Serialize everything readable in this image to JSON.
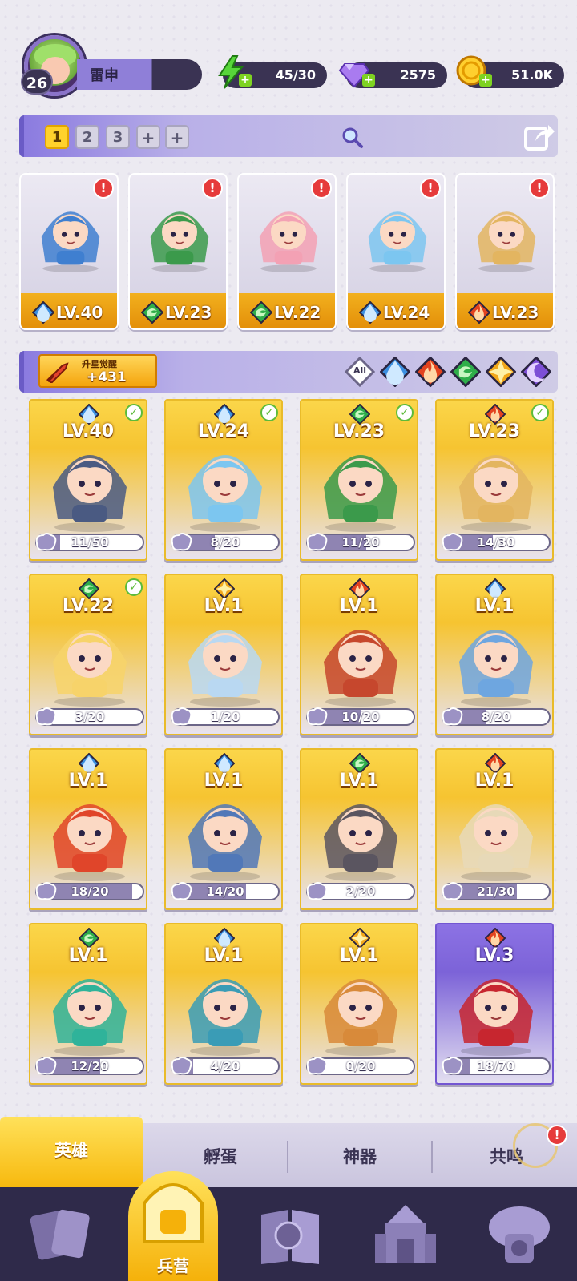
{
  "player": {
    "level": "26",
    "name": "雷申"
  },
  "resources": {
    "energy": "45/30",
    "gems": "2575",
    "gold": "51.0K"
  },
  "team_tabs": [
    "1",
    "2",
    "3",
    "+",
    "+"
  ],
  "team": [
    {
      "level": "LV.40",
      "element": "water",
      "color": "#3f7fd0"
    },
    {
      "level": "LV.23",
      "element": "wind",
      "color": "#3b9a4b"
    },
    {
      "level": "LV.22",
      "element": "wind",
      "color": "#f3a1b4"
    },
    {
      "level": "LV.24",
      "element": "water",
      "color": "#7cc6f0"
    },
    {
      "level": "LV.23",
      "element": "fire",
      "color": "#e3b560"
    }
  ],
  "awaken": {
    "title": "升星觉醒",
    "value": "+431"
  },
  "filters": [
    "All",
    "water",
    "fire",
    "wind",
    "light",
    "dark"
  ],
  "heroes": [
    {
      "level": "LV.40",
      "element": "water",
      "progress": "11/50",
      "ratio": 0.22,
      "checked": true,
      "tint": "#4a5a82"
    },
    {
      "level": "LV.24",
      "element": "water",
      "progress": "8/20",
      "ratio": 0.4,
      "checked": true,
      "tint": "#7cc6f0"
    },
    {
      "level": "LV.23",
      "element": "wind",
      "progress": "11/20",
      "ratio": 0.55,
      "checked": true,
      "tint": "#3b9a4b"
    },
    {
      "level": "LV.23",
      "element": "fire",
      "progress": "14/30",
      "ratio": 0.47,
      "checked": true,
      "tint": "#e3b560"
    },
    {
      "level": "LV.22",
      "element": "wind",
      "progress": "3/20",
      "ratio": 0.15,
      "checked": true,
      "tint": "#f7d36a"
    },
    {
      "level": "LV.1",
      "element": "light",
      "progress": "1/20",
      "ratio": 0.05,
      "checked": false,
      "tint": "#b9d8f2"
    },
    {
      "level": "LV.1",
      "element": "fire",
      "progress": "10/20",
      "ratio": 0.5,
      "checked": false,
      "tint": "#c6472d"
    },
    {
      "level": "LV.1",
      "element": "water",
      "progress": "8/20",
      "ratio": 0.4,
      "checked": false,
      "tint": "#6ea6e0"
    },
    {
      "level": "LV.1",
      "element": "water",
      "progress": "18/20",
      "ratio": 0.9,
      "checked": false,
      "tint": "#e0452a"
    },
    {
      "level": "LV.1",
      "element": "water",
      "progress": "14/20",
      "ratio": 0.7,
      "checked": false,
      "tint": "#5178b8"
    },
    {
      "level": "LV.1",
      "element": "wind",
      "progress": "2/20",
      "ratio": 0.1,
      "checked": false,
      "tint": "#5a5560"
    },
    {
      "level": "LV.1",
      "element": "fire",
      "progress": "21/30",
      "ratio": 0.7,
      "checked": false,
      "tint": "#e7d9b8"
    },
    {
      "level": "LV.1",
      "element": "wind",
      "progress": "12/20",
      "ratio": 0.6,
      "checked": false,
      "tint": "#2fb39a"
    },
    {
      "level": "LV.1",
      "element": "water",
      "progress": "4/20",
      "ratio": 0.2,
      "checked": false,
      "tint": "#3a9cb6"
    },
    {
      "level": "LV.1",
      "element": "light",
      "progress": "0/20",
      "ratio": 0.0,
      "checked": false,
      "tint": "#d88a3a"
    },
    {
      "level": "LV.3",
      "element": "fire",
      "progress": "18/70",
      "ratio": 0.26,
      "checked": false,
      "tint": "#c7262f",
      "purple": true
    }
  ],
  "sub_tabs": [
    "英雄",
    "孵蛋",
    "神器",
    "共鸣"
  ],
  "nav": {
    "active_label": "兵营"
  },
  "element_colors": {
    "water": "#3b8fe0",
    "fire": "#e3431f",
    "wind": "#2fae4a",
    "light": "#f2a81b",
    "dark": "#7d4fd6"
  }
}
